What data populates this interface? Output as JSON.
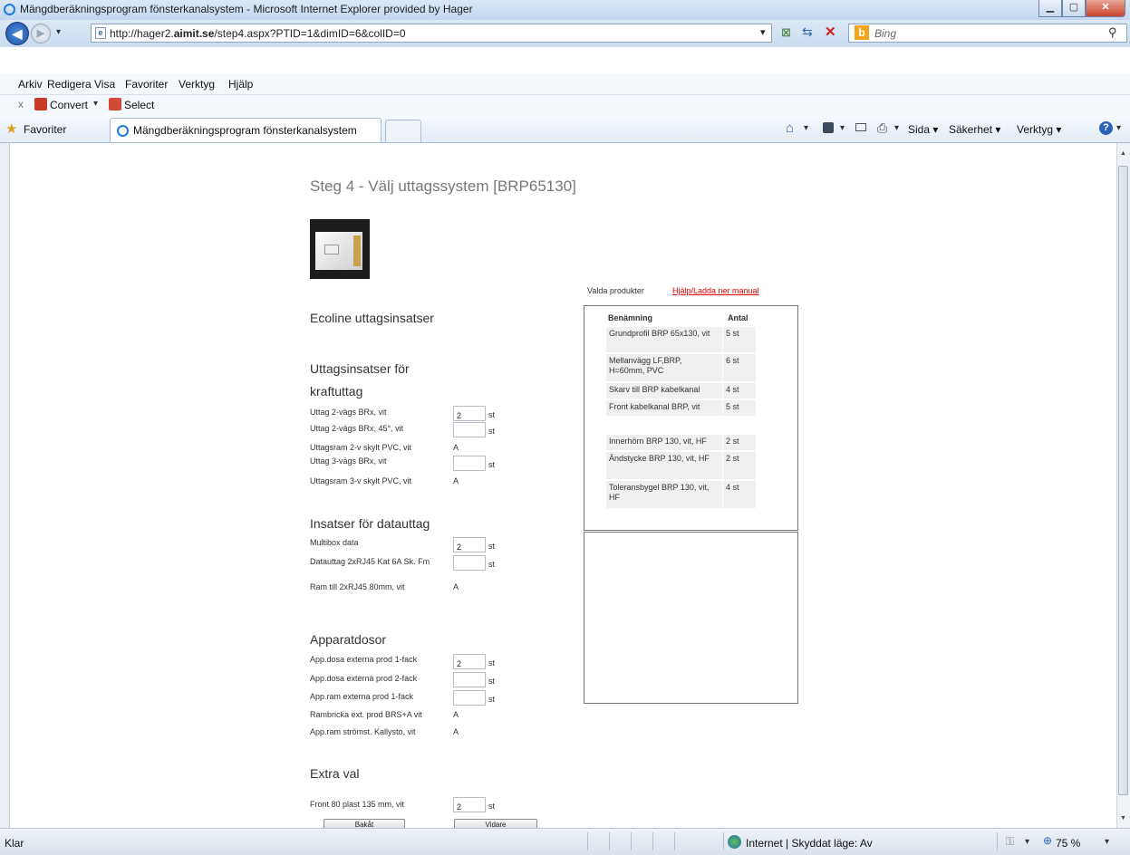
{
  "window": {
    "title": "Mängdberäkningsprogram fönsterkanalsystem - Microsoft Internet Explorer provided by Hager"
  },
  "address_bar": {
    "url_prefix": "http://hager2.",
    "url_domain": "aimit.se",
    "url_suffix": "/step4.aspx?PTID=1&dimID=6&colID=0"
  },
  "search": {
    "placeholder": "Bing"
  },
  "menu": [
    "Arkiv",
    "Redigera",
    "Visa",
    "Favoriter",
    "Verktyg",
    "Hjälp"
  ],
  "toolbar": {
    "close": "x",
    "convert": "Convert",
    "select": "Select"
  },
  "tabs": {
    "favorites": "Favoriter",
    "active_tab": "Mängdberäkningsprogram fönsterkanalsystem"
  },
  "commands": {
    "page": "Sida",
    "safety": "Säkerhet",
    "tools": "Verktyg"
  },
  "page": {
    "heading": "Steg 4 - Välj uttagssystem [BRP65130]",
    "sections": {
      "ecoline": "Ecoline uttagsinsatser",
      "power_line1": "Uttagsinsatser för",
      "power_line2": "kraftuttag",
      "data": "Insatser för datauttag",
      "devices": "Apparatdosor",
      "extra": "Extra val"
    },
    "power_rows": [
      {
        "label": "Uttag 2-vägs BRx, vit",
        "value": "2",
        "unit": "st"
      },
      {
        "label": "Uttag 2-vägs BRx, 45°, vit",
        "value": "",
        "unit": "st"
      },
      {
        "label": "Uttagsram 2-v skylt PVC, vit",
        "mark": "A"
      },
      {
        "label": "Uttag 3-vägs BRx, vit",
        "value": "",
        "unit": "st"
      },
      {
        "label": "Uttagsram 3-v skylt PVC, vit",
        "mark": "A"
      }
    ],
    "data_rows": [
      {
        "label": "Multibox data",
        "value": "2",
        "unit": "st"
      },
      {
        "label": "Datauttag 2xRJ45 Kat 6A Sk. Fm",
        "value": "",
        "unit": "st"
      },
      {
        "label": "Ram till 2xRJ45 80mm, vit",
        "mark": "A"
      }
    ],
    "device_rows": [
      {
        "label": "App.dosa externa prod 1-fack",
        "value": "2",
        "unit": "st"
      },
      {
        "label": "App.dosa externa prod 2-fack",
        "value": "",
        "unit": "st"
      },
      {
        "label": "App.ram externa prod 1-fack",
        "value": "",
        "unit": "st"
      },
      {
        "label": "Rambricka ext. prod BRS+A vit",
        "mark": "A"
      },
      {
        "label": "App.ram strömst. Kallysto, vit",
        "mark": "A"
      }
    ],
    "extra_rows": [
      {
        "label": "Front 80 plast 135 mm, vit",
        "value": "2",
        "unit": "st"
      }
    ],
    "buttons": {
      "back": "Bakåt",
      "next": "Vidare"
    },
    "selected_label": "Valda produkter",
    "help_link": "Hjälp/Ladda ner manual",
    "table_headers": {
      "name": "Benämning",
      "qty": "Antal"
    },
    "products": [
      {
        "name": "Grundprofil BRP 65x130, vit",
        "qty": "5 st"
      },
      {
        "name": "Mellanvägg LF,BRP, H=60mm, PVC",
        "qty": "6 st"
      },
      {
        "name": "Skarv till BRP kabelkanal",
        "qty": "4 st"
      },
      {
        "name": "Front kabelkanal BRP, vit",
        "qty": "5 st"
      },
      {
        "name": "Innerhörn BRP 130, vit, HF",
        "qty": "2 st"
      },
      {
        "name": "Ändstycke BRP 130, vit, HF",
        "qty": "2 st"
      },
      {
        "name": "Toleransbygel BRP 130, vit, HF",
        "qty": "4 st"
      }
    ]
  },
  "status": {
    "left": "Klar",
    "zone": "Internet | Skyddat läge: Av",
    "zoom": "75 %"
  }
}
